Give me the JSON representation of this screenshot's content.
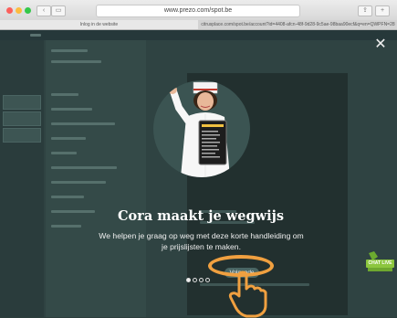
{
  "browser": {
    "url": "www.prezo.com/spot.be",
    "tabs": [
      {
        "label": "Inlog in de website"
      },
      {
        "label": "citrusplace.com/spot.be/account?id=4408-afcn-48f-9d28-9c5ae-98baa90ecf&q=en=QWPFN=28"
      }
    ]
  },
  "onboarding": {
    "title": "Cora maakt je wegwijs",
    "description": "We helpen je graag op weg met deze korte handleiding om je prijslijsten te maken.",
    "next_label": "Volgende",
    "steps_total": 4,
    "current_step": 1,
    "close_icon": "close-icon"
  },
  "badge": {
    "label": "CHAT LIVE"
  },
  "colors": {
    "overlay": "#2c3e3c",
    "highlight": "#f0a040",
    "badge": "#8cc63f"
  }
}
